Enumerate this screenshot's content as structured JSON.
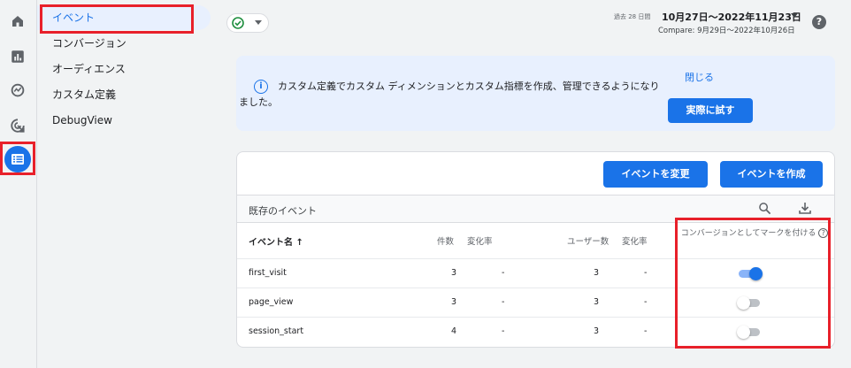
{
  "nav": {
    "items": [
      {
        "label": "イベント",
        "active": true
      },
      {
        "label": "コンバージョン",
        "active": false
      },
      {
        "label": "オーディエンス",
        "active": false
      },
      {
        "label": "カスタム定義",
        "active": false
      },
      {
        "label": "DebugView",
        "active": false
      }
    ]
  },
  "rail": {
    "icons": [
      "home-icon",
      "reports-icon",
      "explore-icon",
      "advertising-icon",
      "configure-icon"
    ]
  },
  "header": {
    "date_range_prefix": "過去 28 日間",
    "date_range": "10月27日～2022年11月23日",
    "compare": "Compare: 9月29日～2022年10月26日",
    "help": "?"
  },
  "banner": {
    "text": "カスタム定義でカスタム ディメンションとカスタム指標を作成、管理できるようになりました。",
    "close_label": "閉じる",
    "try_label": "実際に試す"
  },
  "card": {
    "modify_label": "イベントを変更",
    "create_label": "イベントを作成",
    "sub_title": "既存のイベント",
    "columns": {
      "event_name": "イベント名",
      "count": "件数",
      "count_change": "変化率",
      "users": "ユーザー数",
      "users_change": "変化率",
      "mark_as_conversion": "コンバージョンとしてマークを付ける"
    },
    "rows": [
      {
        "name": "first_visit",
        "count": "3",
        "count_change": "-",
        "users": "3",
        "users_change": "-",
        "conversion": true
      },
      {
        "name": "page_view",
        "count": "3",
        "count_change": "-",
        "users": "3",
        "users_change": "-",
        "conversion": false
      },
      {
        "name": "session_start",
        "count": "4",
        "count_change": "-",
        "users": "3",
        "users_change": "-",
        "conversion": false
      }
    ]
  },
  "colors": {
    "accent": "#1a73e8",
    "highlight_box": "#e8202a"
  }
}
